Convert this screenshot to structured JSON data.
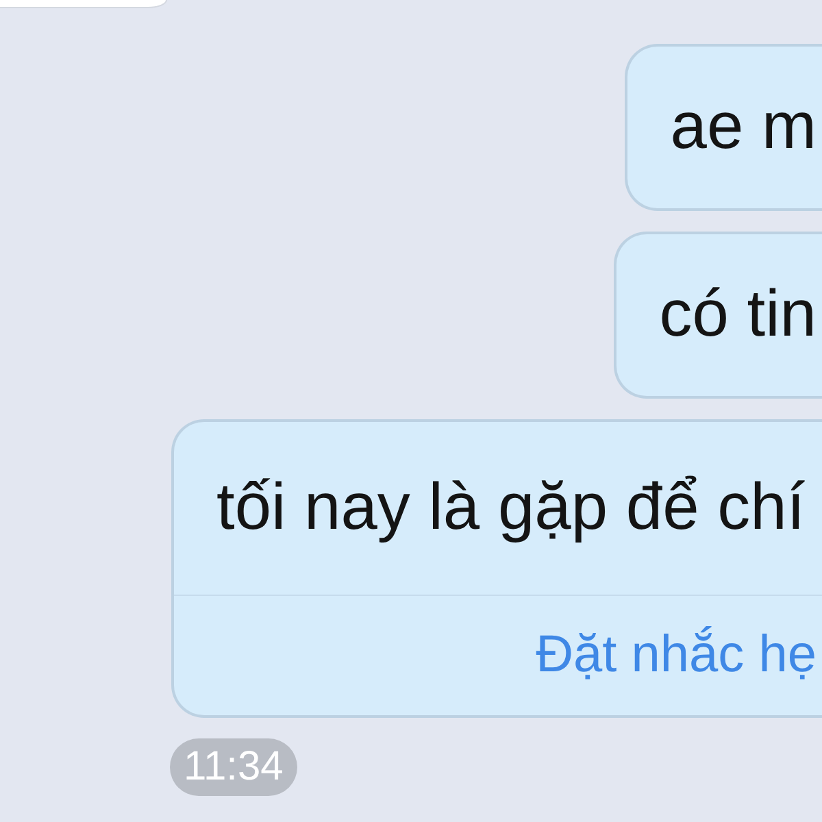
{
  "messages": [
    {
      "kind": "incoming_cut"
    },
    {
      "kind": "outgoing",
      "text": "ae m"
    },
    {
      "kind": "outgoing",
      "text": "có tin"
    },
    {
      "kind": "outgoing",
      "text": "tối nay là gặp để chí",
      "action": "Đặt nhắc hẹ"
    }
  ],
  "time": "11:34"
}
